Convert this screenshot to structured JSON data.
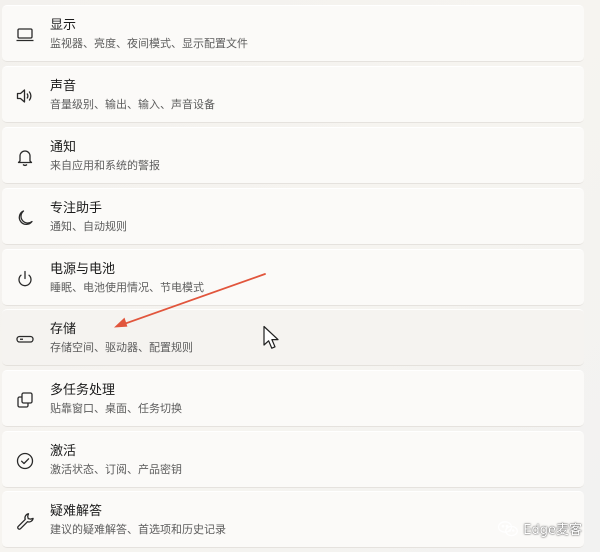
{
  "settings": {
    "items": [
      {
        "title": "显示",
        "subtitle": "监视器、亮度、夜间模式、显示配置文件",
        "icon": "monitor-icon"
      },
      {
        "title": "声音",
        "subtitle": "音量级别、输出、输入、声音设备",
        "icon": "speaker-icon"
      },
      {
        "title": "通知",
        "subtitle": "来自应用和系统的警报",
        "icon": "bell-icon"
      },
      {
        "title": "专注助手",
        "subtitle": "通知、自动规则",
        "icon": "moon-icon"
      },
      {
        "title": "电源与电池",
        "subtitle": "睡眠、电池使用情况、节电模式",
        "icon": "power-icon"
      },
      {
        "title": "存储",
        "subtitle": "存储空间、驱动器、配置规则",
        "icon": "storage-icon"
      },
      {
        "title": "多任务处理",
        "subtitle": "贴靠窗口、桌面、任务切换",
        "icon": "multitask-icon"
      },
      {
        "title": "激活",
        "subtitle": "激活状态、订阅、产品密钥",
        "icon": "check-circle-icon"
      },
      {
        "title": "疑难解答",
        "subtitle": "建议的疑难解答、首选项和历史记录",
        "icon": "wrench-icon"
      }
    ]
  },
  "watermark": {
    "text": "Edge麦客",
    "icon": "wechat-icon"
  },
  "colors": {
    "annotation_arrow": "#e1553c",
    "title_text": "#1b1b1b",
    "subtitle_text": "#5d5d5d"
  }
}
